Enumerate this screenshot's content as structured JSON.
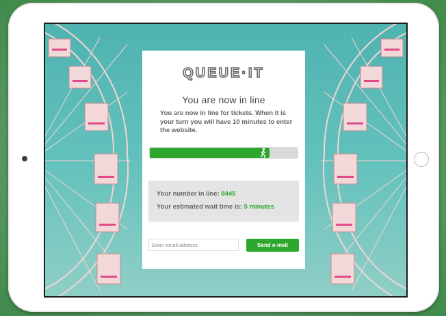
{
  "logo": {
    "text": "QUEUE·IT"
  },
  "queue": {
    "title": "You are now in line",
    "description": "You are now in line for tickets. When it is your turn you will have 10 minutes to enter the website.",
    "progress_percent": 81,
    "number_label": "Your number in line:",
    "number_value": "8445",
    "wait_label": "Your estimated wait time is:",
    "wait_value": "5 minutes"
  },
  "email": {
    "placeholder": "Enter email address",
    "value": "",
    "send_label": "Send e-mail"
  },
  "colors": {
    "accent_green": "#2ea72e",
    "sky_teal": "#5ebdb8",
    "wheel_pink": "#e9a6ab",
    "logo_gray": "#6a6a6a",
    "page_background_green": "#5f9a66"
  },
  "icons": {
    "walker": "walking-person-icon",
    "camera": "front-camera-icon",
    "home": "home-button-icon"
  }
}
